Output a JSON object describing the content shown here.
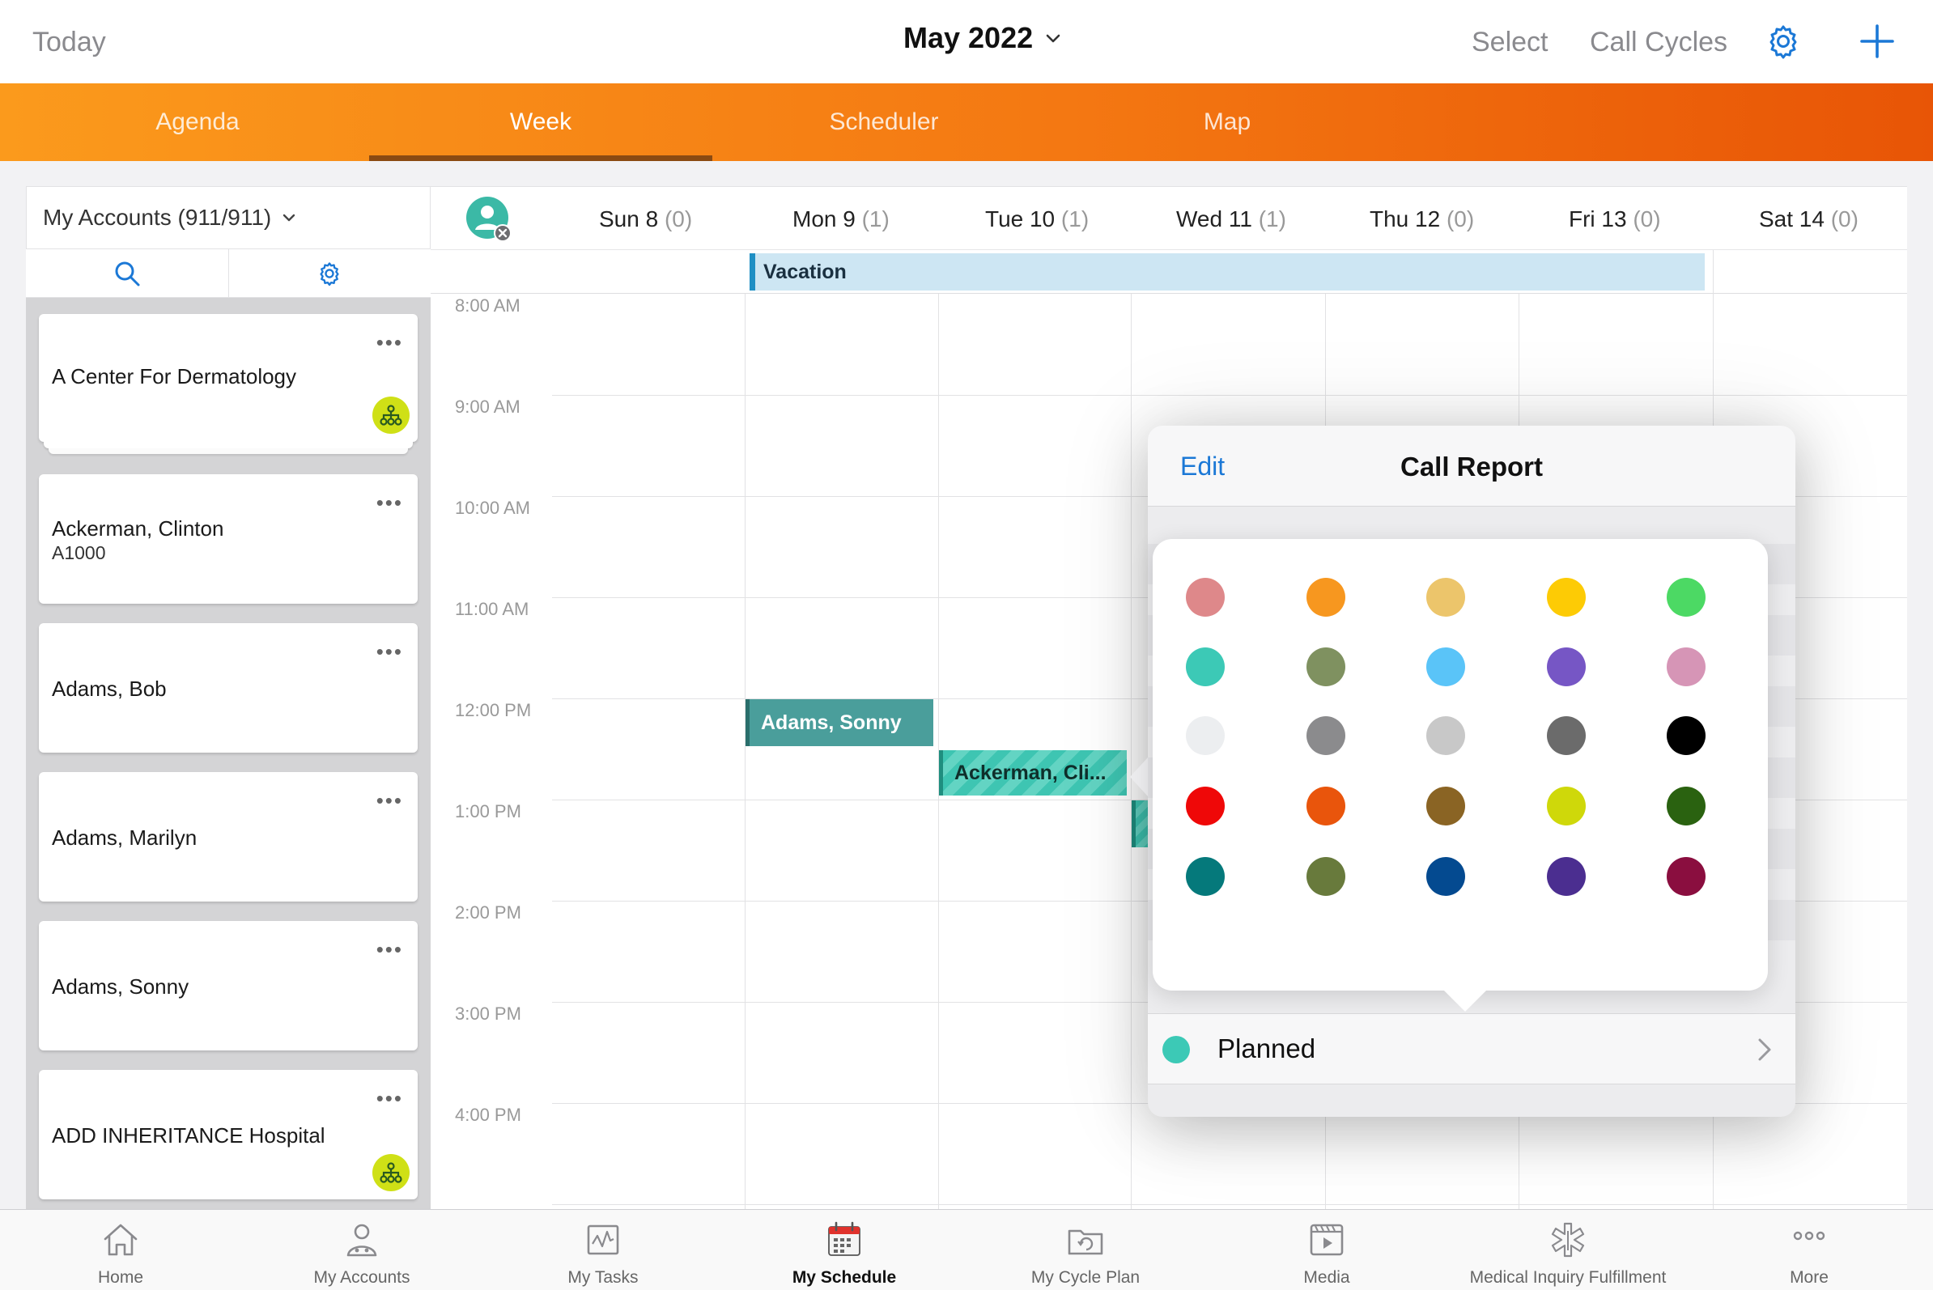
{
  "topbar": {
    "today": "Today",
    "title": "May 2022",
    "select": "Select",
    "call_cycles": "Call Cycles",
    "icons": [
      "chevron-down-icon",
      "gear-icon",
      "plus-icon"
    ],
    "accent_color": "#1b78d6"
  },
  "tabs": [
    {
      "label": "Agenda",
      "active": false
    },
    {
      "label": "Week",
      "active": true
    },
    {
      "label": "Scheduler",
      "active": false
    },
    {
      "label": "Map",
      "active": false
    }
  ],
  "accounts_panel": {
    "filter_label": "My Accounts (911/911)",
    "icons": [
      "search-icon",
      "gear-icon"
    ],
    "cards": [
      {
        "name": "A Center For Dermatology",
        "sub": "",
        "badge": "hierarchy-icon"
      },
      {
        "name": "Ackerman, Clinton",
        "sub": "A1000",
        "badge": ""
      },
      {
        "name": "Adams, Bob",
        "sub": "",
        "badge": ""
      },
      {
        "name": "Adams, Marilyn",
        "sub": "",
        "badge": ""
      },
      {
        "name": "Adams, Sonny",
        "sub": "",
        "badge": ""
      },
      {
        "name": "ADD INHERITANCE Hospital",
        "sub": "",
        "badge": "hierarchy-icon"
      }
    ],
    "more_glyph": "•••"
  },
  "calendar": {
    "days": [
      {
        "label": "Sun 8",
        "count": "(0)"
      },
      {
        "label": "Mon 9",
        "count": "(1)"
      },
      {
        "label": "Tue 10",
        "count": "(1)"
      },
      {
        "label": "Wed 11",
        "count": "(1)"
      },
      {
        "label": "Thu 12",
        "count": "(0)"
      },
      {
        "label": "Fri 13",
        "count": "(0)"
      },
      {
        "label": "Sat 14",
        "count": "(0)"
      }
    ],
    "all_day_event": "Vacation",
    "times": [
      "8:00 AM",
      "9:00 AM",
      "10:00 AM",
      "11:00 AM",
      "12:00 PM",
      "1:00 PM",
      "2:00 PM",
      "3:00 PM",
      "4:00 PM"
    ],
    "events": [
      {
        "title": "Adams, Sonny",
        "day": "Mon 9",
        "start": "12:00 PM",
        "end": "12:30 PM"
      },
      {
        "title": "Ackerman, Cli...",
        "day": "Tue 10",
        "start": "12:30 PM",
        "end": "1:00 PM"
      }
    ]
  },
  "popover": {
    "edit": "Edit",
    "title": "Call Report",
    "colors": [
      [
        "#de888a",
        "#f7971f",
        "#ecc56b",
        "#fdcb05",
        "#4cd964"
      ],
      [
        "#3cc9b6",
        "#7f9160",
        "#5ac4f8",
        "#7656c5",
        "#d695b6"
      ],
      [
        "#eceef0",
        "#8b8b8d",
        "#c8c8c8",
        "#6b6b6b",
        "#000000"
      ],
      [
        "#ef0808",
        "#e9550c",
        "#8a6424",
        "#cfd80a",
        "#2a6210"
      ],
      [
        "#05797b",
        "#687a3c",
        "#044a90",
        "#4b2e90",
        "#8a0e3f"
      ]
    ],
    "status": {
      "label": "Planned",
      "color": "#3cc9b6"
    }
  },
  "bottom_nav": [
    {
      "label": "Home",
      "icon": "home-icon",
      "active": false
    },
    {
      "label": "My Accounts",
      "icon": "accounts-icon",
      "active": false
    },
    {
      "label": "My Tasks",
      "icon": "tasks-icon",
      "active": false
    },
    {
      "label": "My Schedule",
      "icon": "schedule-icon",
      "active": true
    },
    {
      "label": "My Cycle Plan",
      "icon": "cycle-plan-icon",
      "active": false
    },
    {
      "label": "Media",
      "icon": "media-icon",
      "active": false
    },
    {
      "label": "Medical Inquiry Fulfillment",
      "icon": "medical-inquiry-icon",
      "active": false
    },
    {
      "label": "More",
      "icon": "more-icon",
      "active": false
    }
  ]
}
